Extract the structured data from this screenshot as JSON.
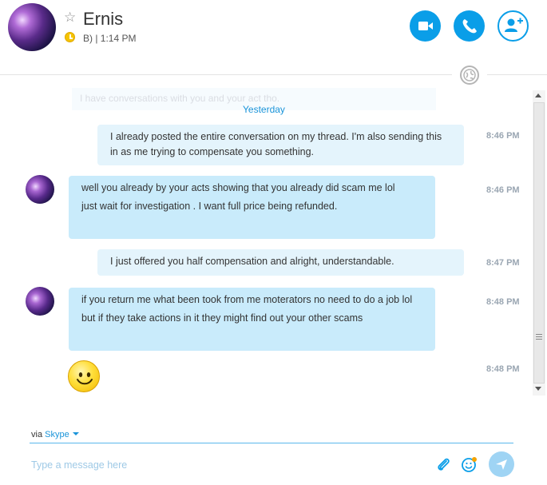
{
  "contact": {
    "name": "Ernis",
    "mood": "B) | 1:14 PM"
  },
  "header": {
    "video_call_icon": "video-camera-icon",
    "call_icon": "phone-icon",
    "add_people_icon": "add-person-icon"
  },
  "chat": {
    "faded_preview": "I have conversations with you and your act tho.",
    "day_separator": "Yesterday",
    "messages": [
      {
        "direction": "out",
        "lines": [
          "I already posted the entire conversation on my thread. I'm also sending this in as me trying to compensate you something."
        ],
        "time": "8:46 PM"
      },
      {
        "direction": "in",
        "lines": [
          "well you already by your acts showing that you already did scam me lol",
          "just wait for investigation . I want full price being refunded."
        ],
        "time": "8:46 PM"
      },
      {
        "direction": "out",
        "lines": [
          "I just offered you half compensation and alright, understandable."
        ],
        "time": "8:47 PM"
      },
      {
        "direction": "in",
        "lines": [
          "if you return me what been took from me moterators no need to do a job lol",
          "but if they take actions in it they might find out your other scams"
        ],
        "time": "8:48 PM"
      },
      {
        "direction": "in",
        "emoji": "smile-emoticon",
        "time": "8:48 PM"
      }
    ]
  },
  "compose": {
    "via_label": "via",
    "via_service": "Skype",
    "placeholder": "Type a message here"
  },
  "colors": {
    "accent": "#0a9ee8",
    "bubble_out": "#e4f4fc",
    "bubble_in": "#c9ebfb",
    "time": "#9aa6b2"
  }
}
